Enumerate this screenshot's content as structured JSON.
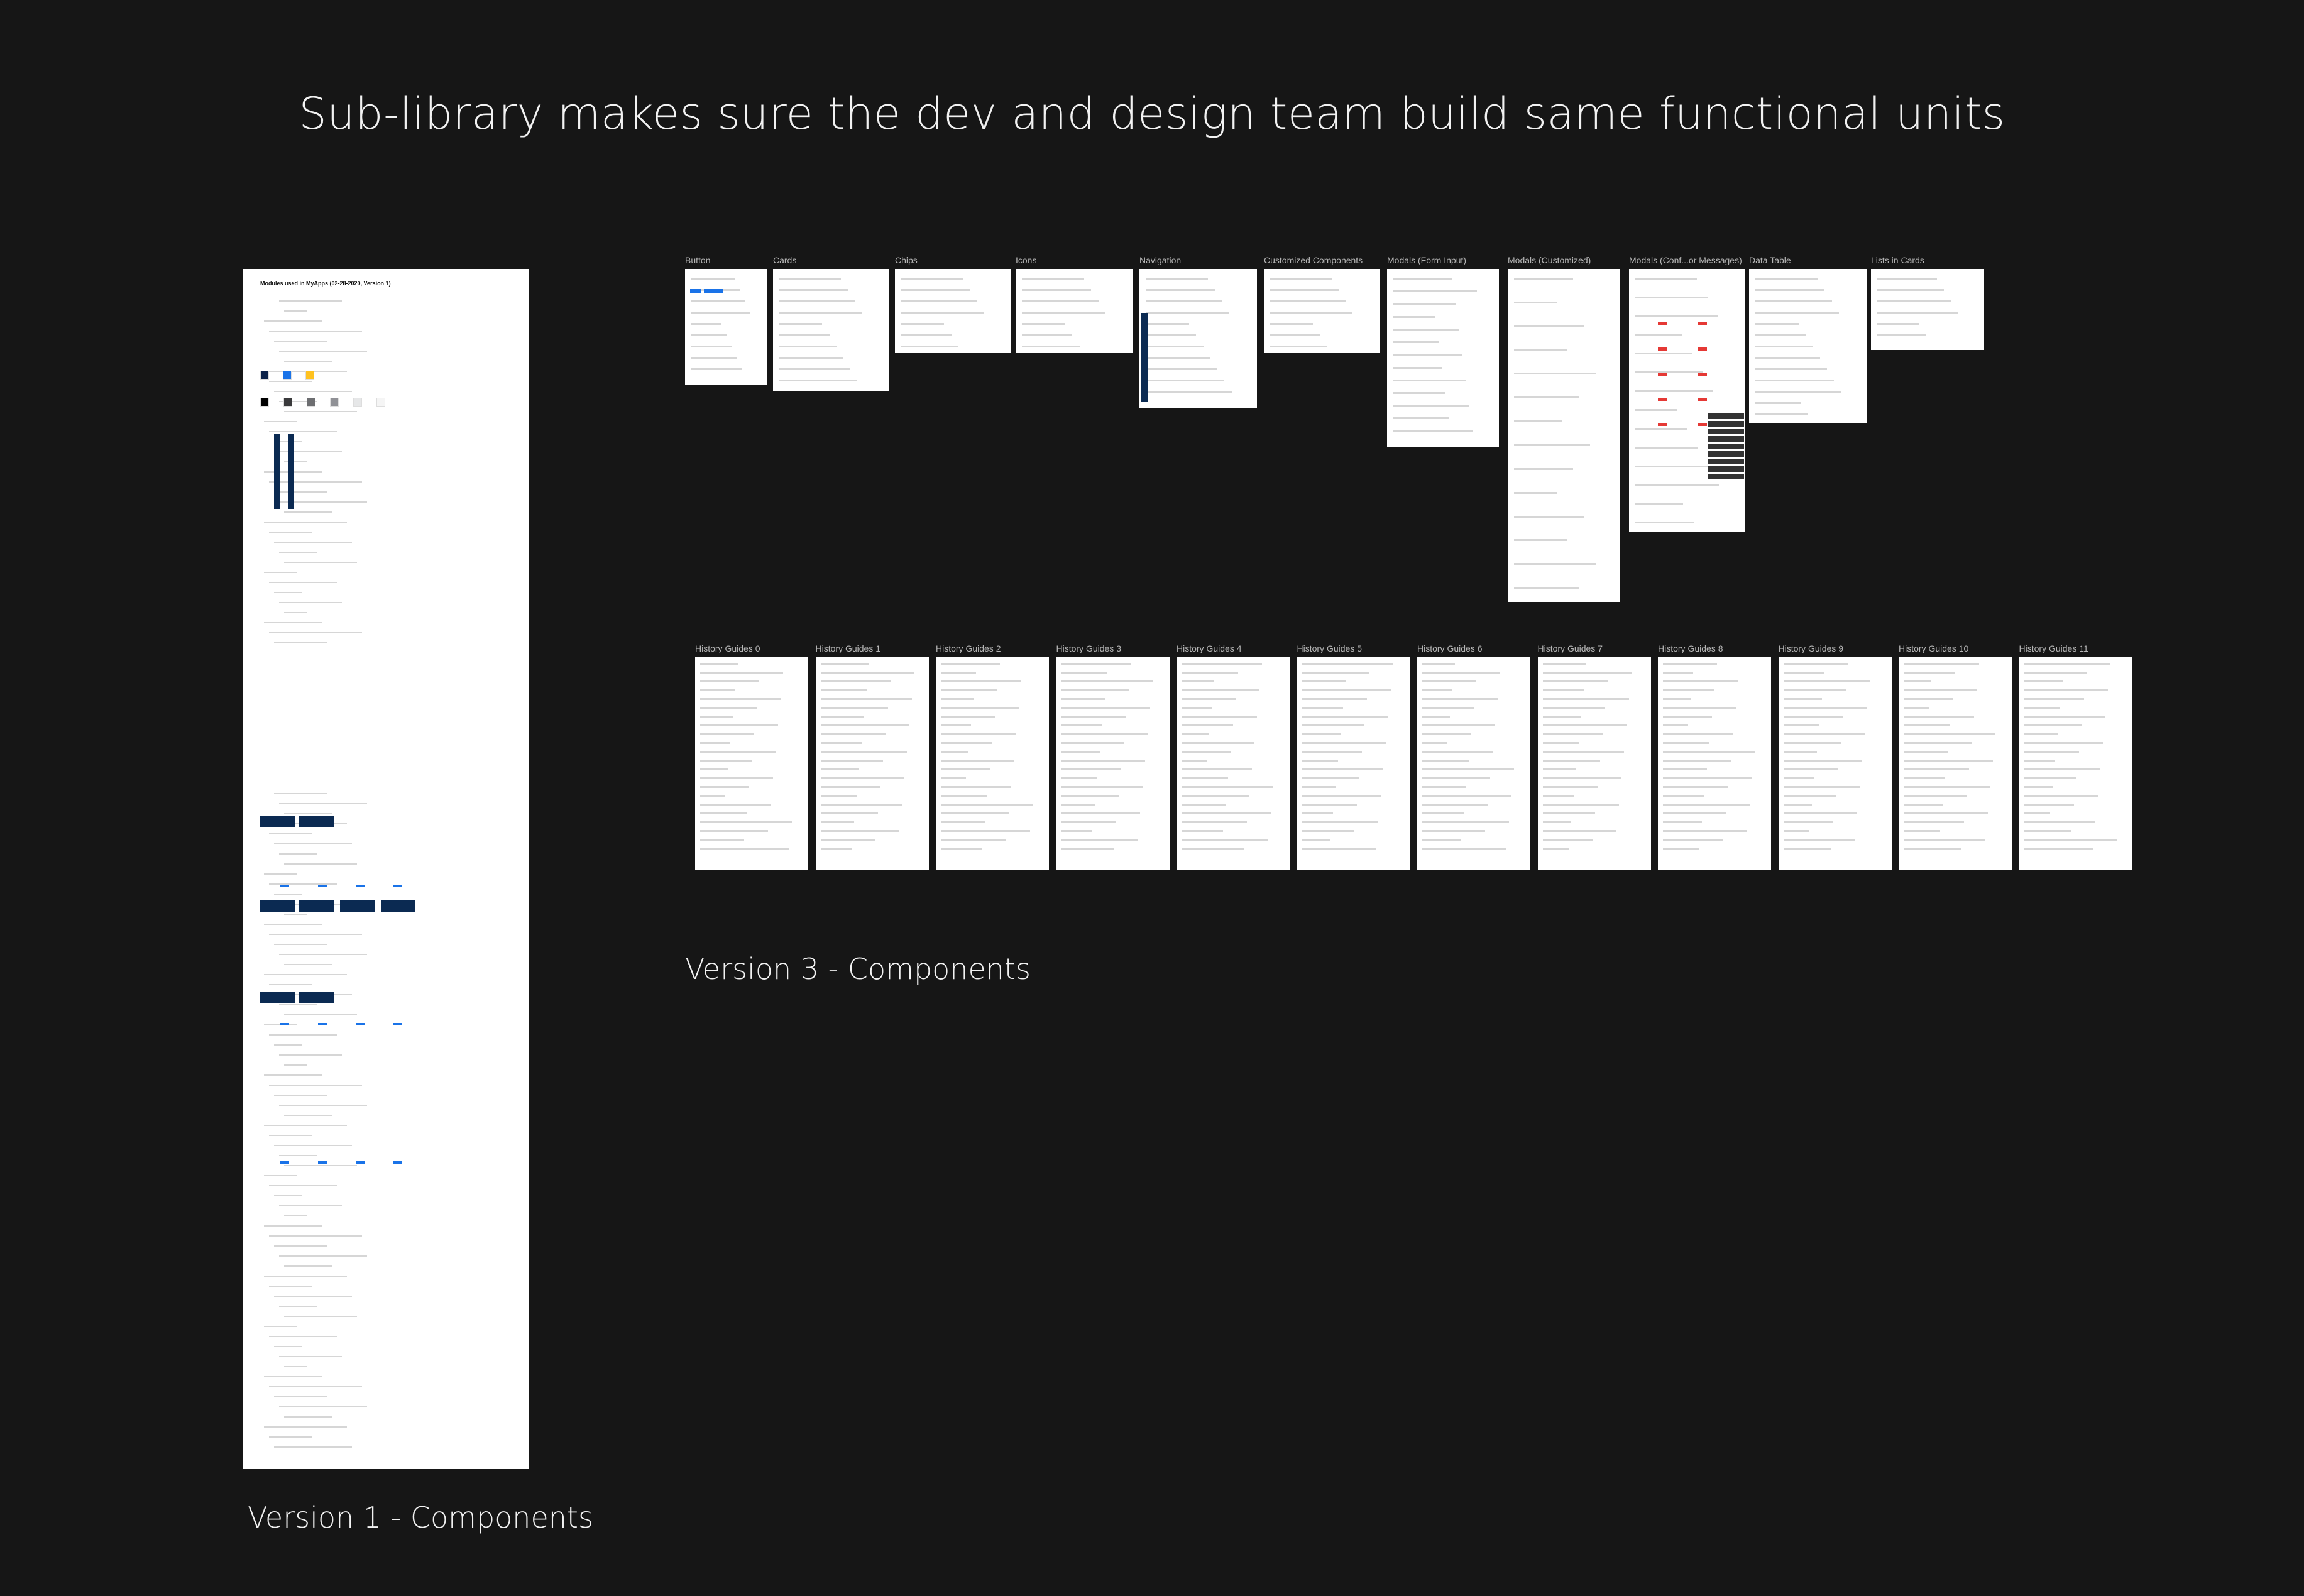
{
  "headline": "Sub-library makes sure the dev and design team build same functional units",
  "version1": {
    "caption": "Version 1 - Components",
    "doc_title": "Modules used in MyApps (02-28-2020, Version 1)",
    "swatches": [
      "#0b2149",
      "#1a73e8",
      "#ffc220",
      "#000000",
      "#3a3a3c",
      "#6d6e71",
      "#909196",
      "#e6e7e8",
      "#f5f5f5"
    ]
  },
  "version3": {
    "caption": "Version 3 - Components",
    "frames": [
      {
        "label": "Button"
      },
      {
        "label": "Cards"
      },
      {
        "label": "Chips"
      },
      {
        "label": "Icons"
      },
      {
        "label": "Navigation"
      },
      {
        "label": "Customized Components"
      },
      {
        "label": "Modals (Form Input)"
      },
      {
        "label": "Modals (Customized)"
      },
      {
        "label": "Modals (Conf...or Messages)"
      },
      {
        "label": "Data Table"
      },
      {
        "label": "Lists in Cards"
      }
    ],
    "history": [
      {
        "label": "History Guides 0"
      },
      {
        "label": "History Guides 1"
      },
      {
        "label": "History Guides 2"
      },
      {
        "label": "History Guides 3"
      },
      {
        "label": "History Guides 4"
      },
      {
        "label": "History Guides 5"
      },
      {
        "label": "History Guides 6"
      },
      {
        "label": "History Guides 7"
      },
      {
        "label": "History Guides 8"
      },
      {
        "label": "History Guides 9"
      },
      {
        "label": "History Guides 10"
      },
      {
        "label": "History Guides 11"
      }
    ]
  }
}
